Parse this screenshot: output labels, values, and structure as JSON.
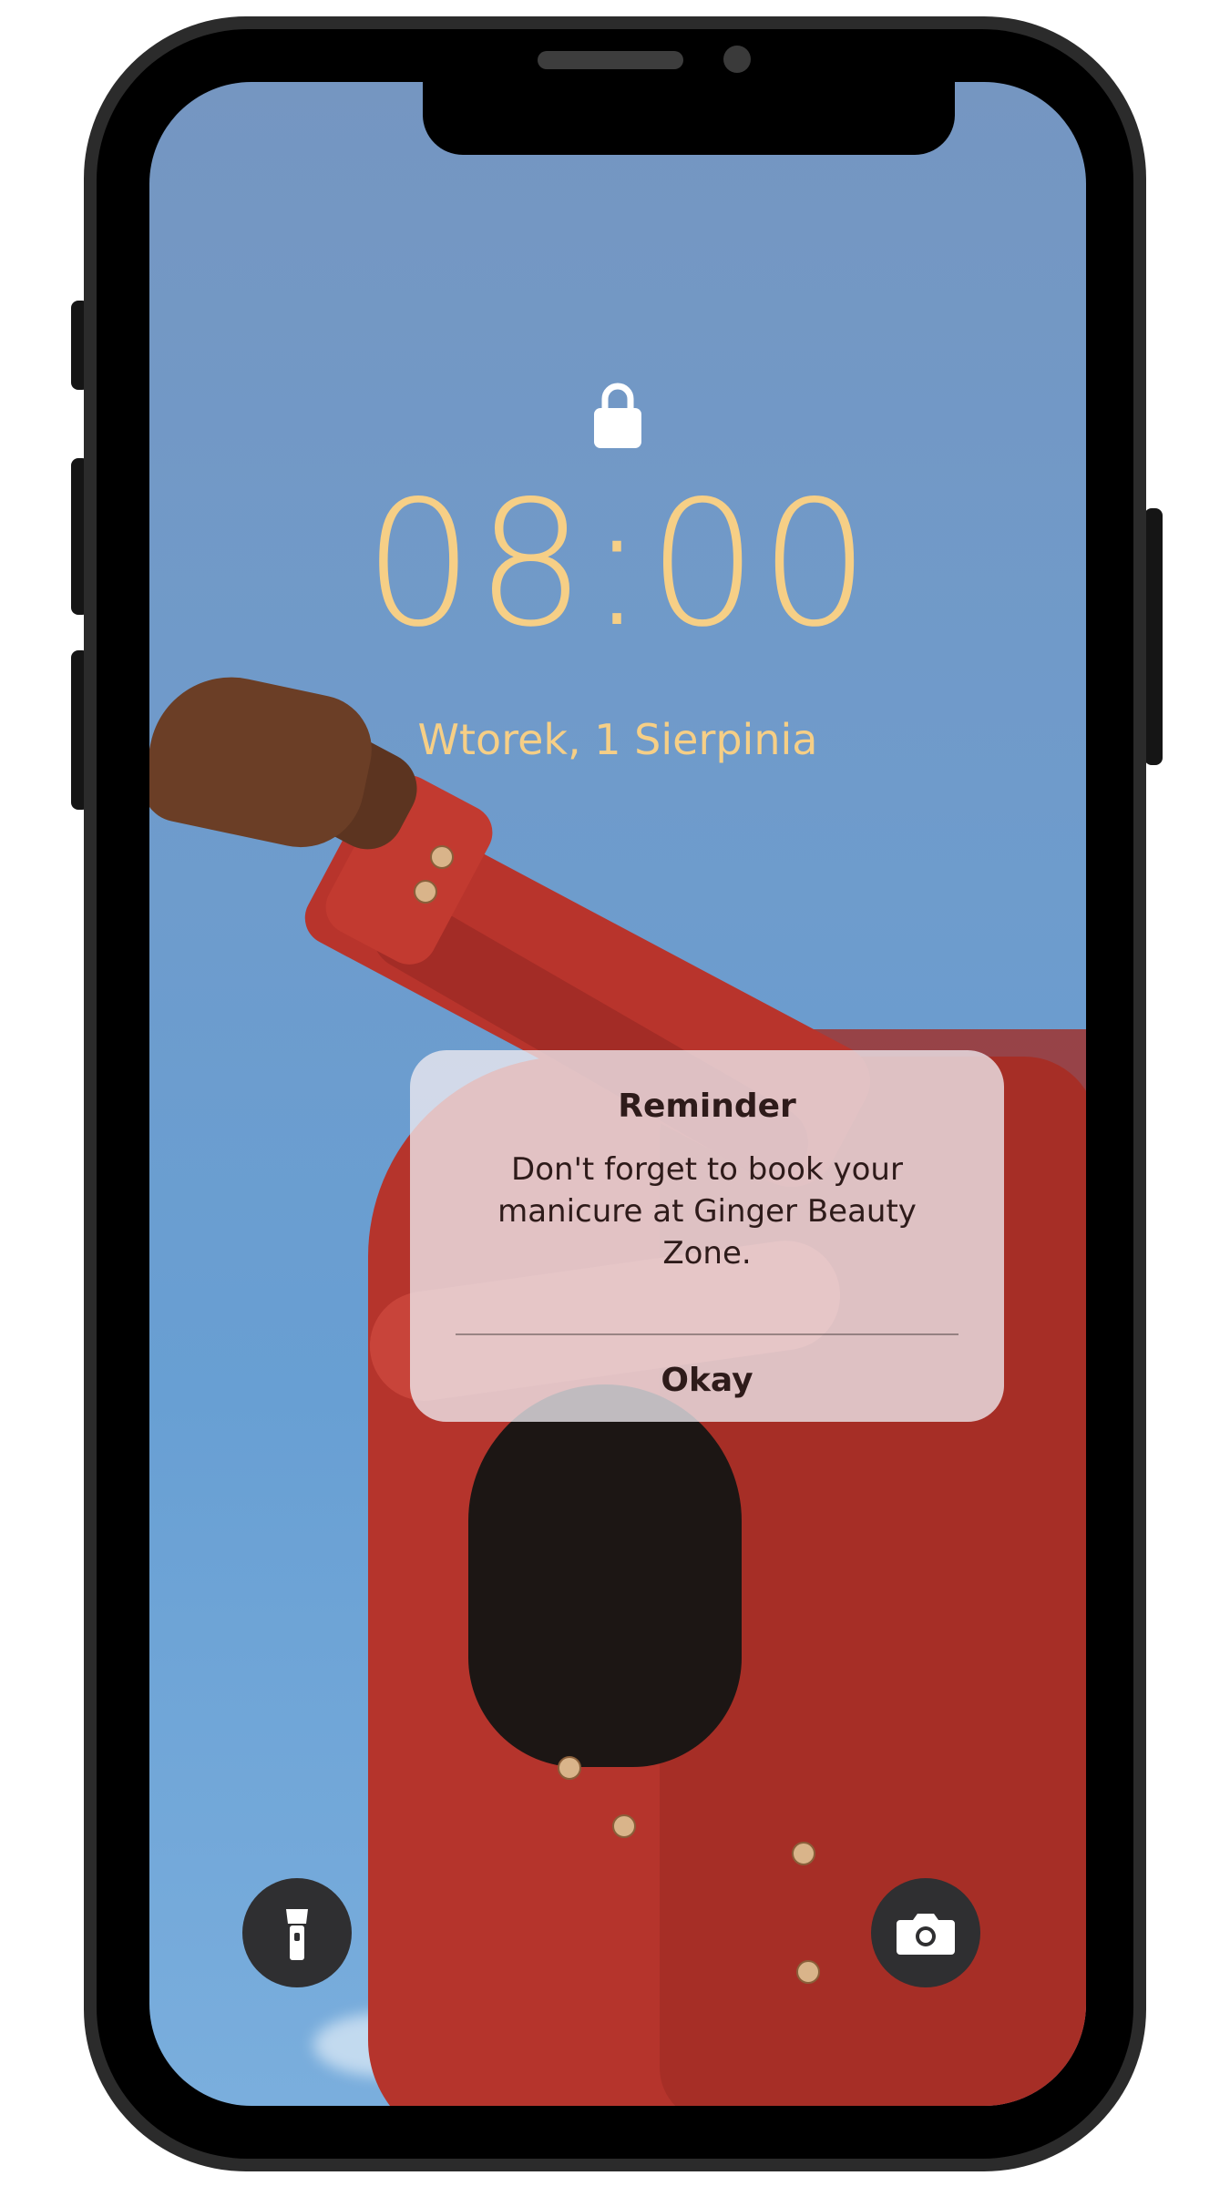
{
  "lock_screen": {
    "time": "08:00",
    "date": "Wtorek, 1 Sierpinia",
    "lock_icon": "lock-icon",
    "accent_color": "#f6cf86"
  },
  "alert": {
    "title": "Reminder",
    "message": "Don't forget to book your manicure at Ginger Beauty Zone.",
    "button_label": "Okay"
  },
  "quick_actions": {
    "left_icon": "flashlight-icon",
    "right_icon": "camera-icon"
  }
}
